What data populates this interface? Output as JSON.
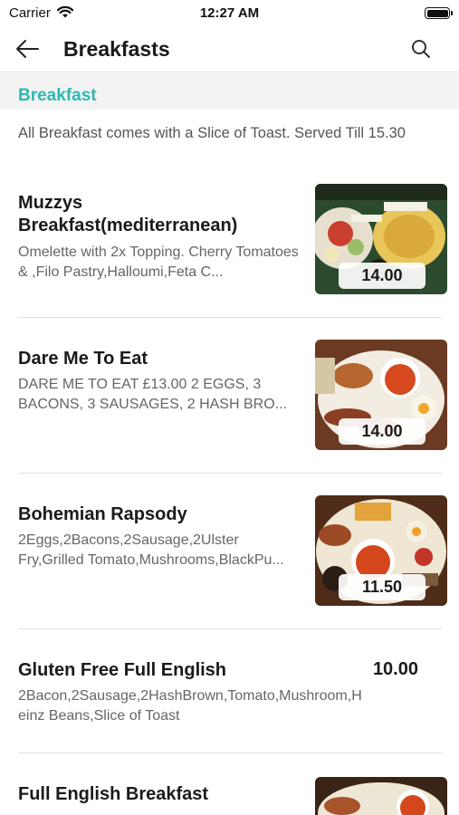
{
  "status_bar": {
    "carrier": "Carrier",
    "time": "12:27 AM"
  },
  "header": {
    "title": "Breakfasts"
  },
  "section": {
    "title": "Breakfast",
    "description": "All Breakfast comes with a Slice of Toast. Served Till 15.30"
  },
  "items": [
    {
      "name": "Muzzys Breakfast(mediterranean)",
      "description": "Omelette with 2x Topping. Cherry Tomatoes & ,Filo Pastry,Halloumi,Feta C...",
      "price": "14.00"
    },
    {
      "name": "Dare Me To Eat",
      "description": "DARE ME TO EAT £13.00 2 EGGS, 3 BACONS, 3 SAUSAGES, 2 HASH BRO...",
      "price": "14.00"
    },
    {
      "name": "Bohemian Rapsody",
      "description": "2Eggs,2Bacons,2Sausage,2Ulster Fry,Grilled Tomato,Mushrooms,BlackPu...",
      "price": "11.50"
    },
    {
      "name": "Gluten Free Full English",
      "description": "2Bacon,2Sausage,2HashBrown,Tomato,Mushroom,Heinz Beans,Slice of Toast",
      "price": "10.00"
    },
    {
      "name": "Full English Breakfast"
    }
  ],
  "colors": {
    "accent": "#2fb7b0",
    "section_bg": "#f3f3f3",
    "divider": "#e0e0e0"
  },
  "icons": {
    "back": "arrow-left-icon",
    "search": "search-icon",
    "wifi": "wifi-icon",
    "battery": "battery-icon"
  }
}
